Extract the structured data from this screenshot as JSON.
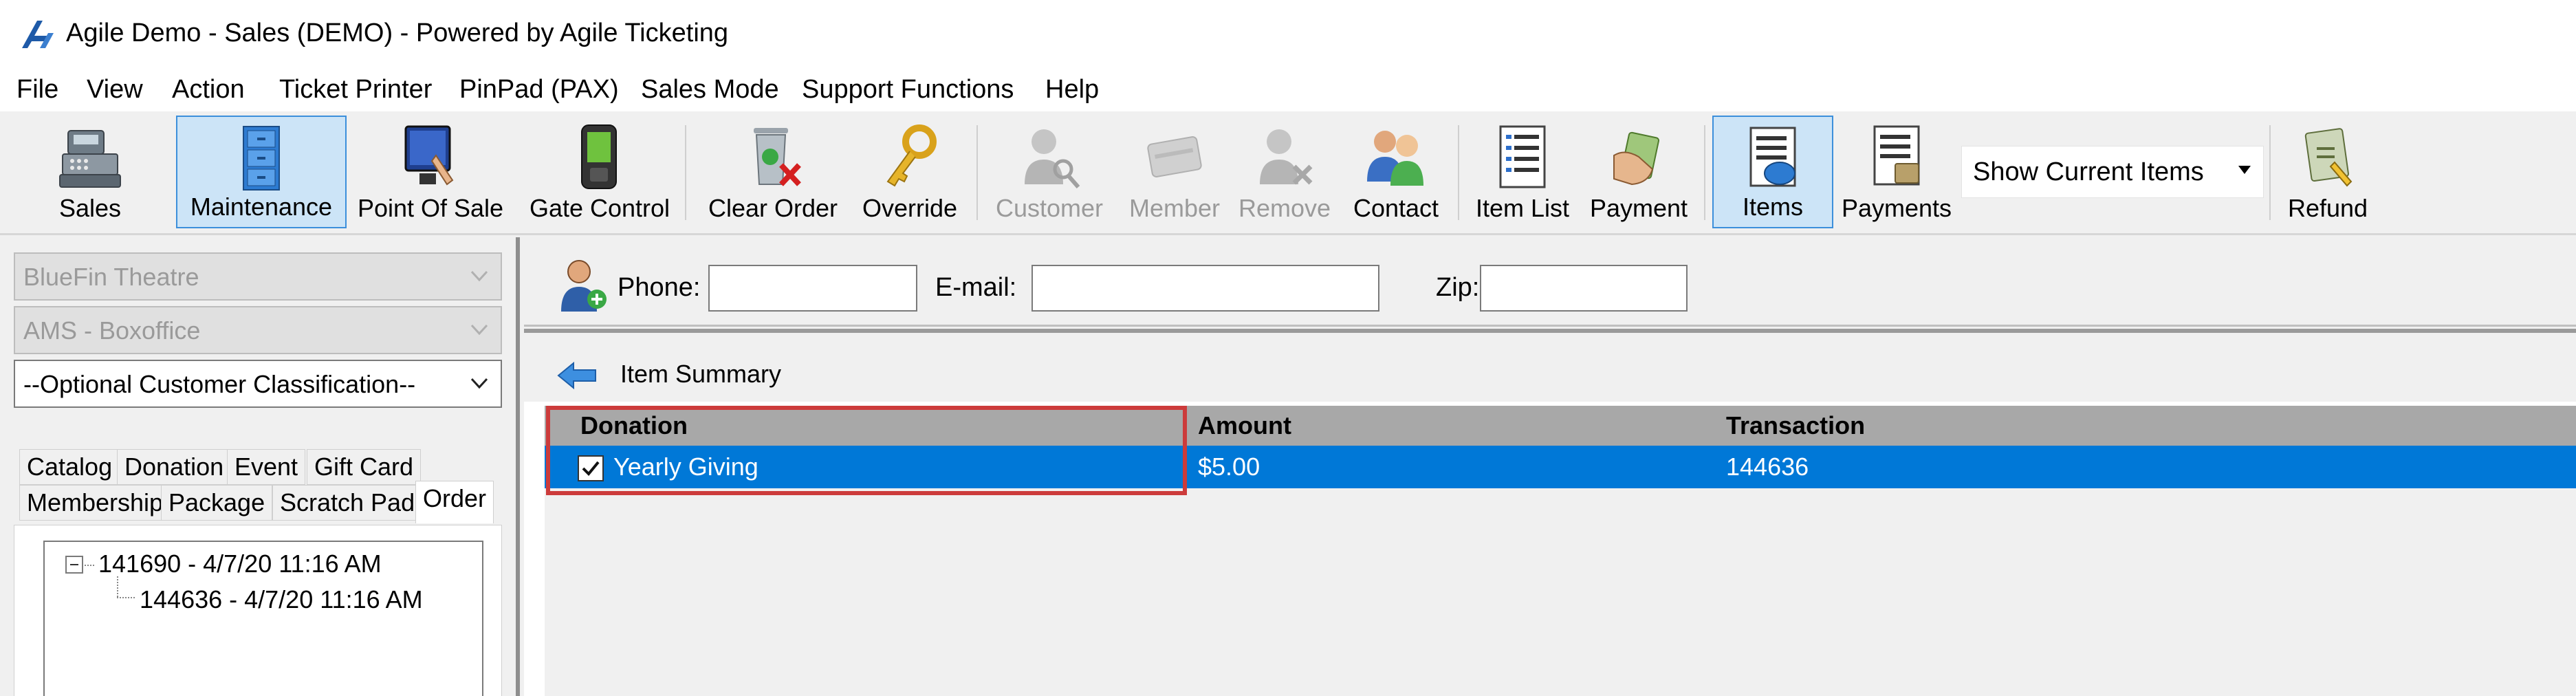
{
  "window": {
    "title": "Agile Demo - Sales (DEMO) - Powered by Agile Ticketing",
    "logo_icon": "agile-logo-icon"
  },
  "menu": {
    "items": [
      "File",
      "View",
      "Action",
      "Ticket Printer",
      "PinPad (PAX)",
      "Sales Mode",
      "Support Functions",
      "Help"
    ]
  },
  "toolbar": {
    "buttons": [
      {
        "label": "Sales",
        "icon": "cash-register-icon",
        "state": "normal"
      },
      {
        "label": "Maintenance",
        "icon": "filing-cabinet-icon",
        "state": "active"
      },
      {
        "label": "Point Of Sale",
        "icon": "touchscreen-icon",
        "state": "normal"
      },
      {
        "label": "Gate Control",
        "icon": "handheld-scanner-icon",
        "state": "normal"
      },
      {
        "label": "Clear Order",
        "icon": "trash-can-icon",
        "state": "normal"
      },
      {
        "label": "Override",
        "icon": "key-icon",
        "state": "normal"
      },
      {
        "label": "Customer",
        "icon": "customer-search-icon",
        "state": "disabled"
      },
      {
        "label": "Member",
        "icon": "member-card-icon",
        "state": "disabled"
      },
      {
        "label": "Remove",
        "icon": "remove-person-icon",
        "state": "disabled"
      },
      {
        "label": "Contact",
        "icon": "contacts-icon",
        "state": "normal"
      },
      {
        "label": "Item List",
        "icon": "item-list-icon",
        "state": "normal"
      },
      {
        "label": "Payment",
        "icon": "payment-hand-icon",
        "state": "normal"
      },
      {
        "label": "Items",
        "icon": "items-view-icon",
        "state": "active"
      },
      {
        "label": "Payments",
        "icon": "payments-view-icon",
        "state": "normal"
      },
      {
        "label": "Refund",
        "icon": "refund-icon",
        "state": "normal"
      }
    ],
    "view_select": {
      "value": "Show Current Items"
    }
  },
  "left_pane": {
    "organization": "BlueFin Theatre",
    "location": "AMS - Boxoffice",
    "classification": "--Optional Customer Classification--",
    "tabs_row1": [
      "Catalog",
      "Donation",
      "Event",
      "Gift Card"
    ],
    "tabs_row2": [
      "Membership",
      "Package",
      "Scratch Pad",
      "Order"
    ],
    "active_tab": "Order",
    "tree": {
      "root": "141690 - 4/7/20 11:16 AM",
      "child": "144636 - 4/7/20 11:16 AM"
    }
  },
  "customer_bar": {
    "phone_label": "Phone:",
    "phone_value": "",
    "email_label": "E-mail:",
    "email_value": "",
    "zip_label": "Zip:",
    "zip_value": ""
  },
  "item_summary": {
    "title": "Item Summary",
    "columns": [
      "Donation",
      "Amount",
      "Transaction"
    ],
    "rows": [
      {
        "checked": true,
        "donation": "Yearly Giving",
        "amount": "$5.00",
        "transaction": "144636"
      }
    ]
  },
  "colors": {
    "selection_blue": "#0078d7",
    "active_button_bg": "#cce4f7",
    "highlight_red": "#cc3b3b"
  }
}
